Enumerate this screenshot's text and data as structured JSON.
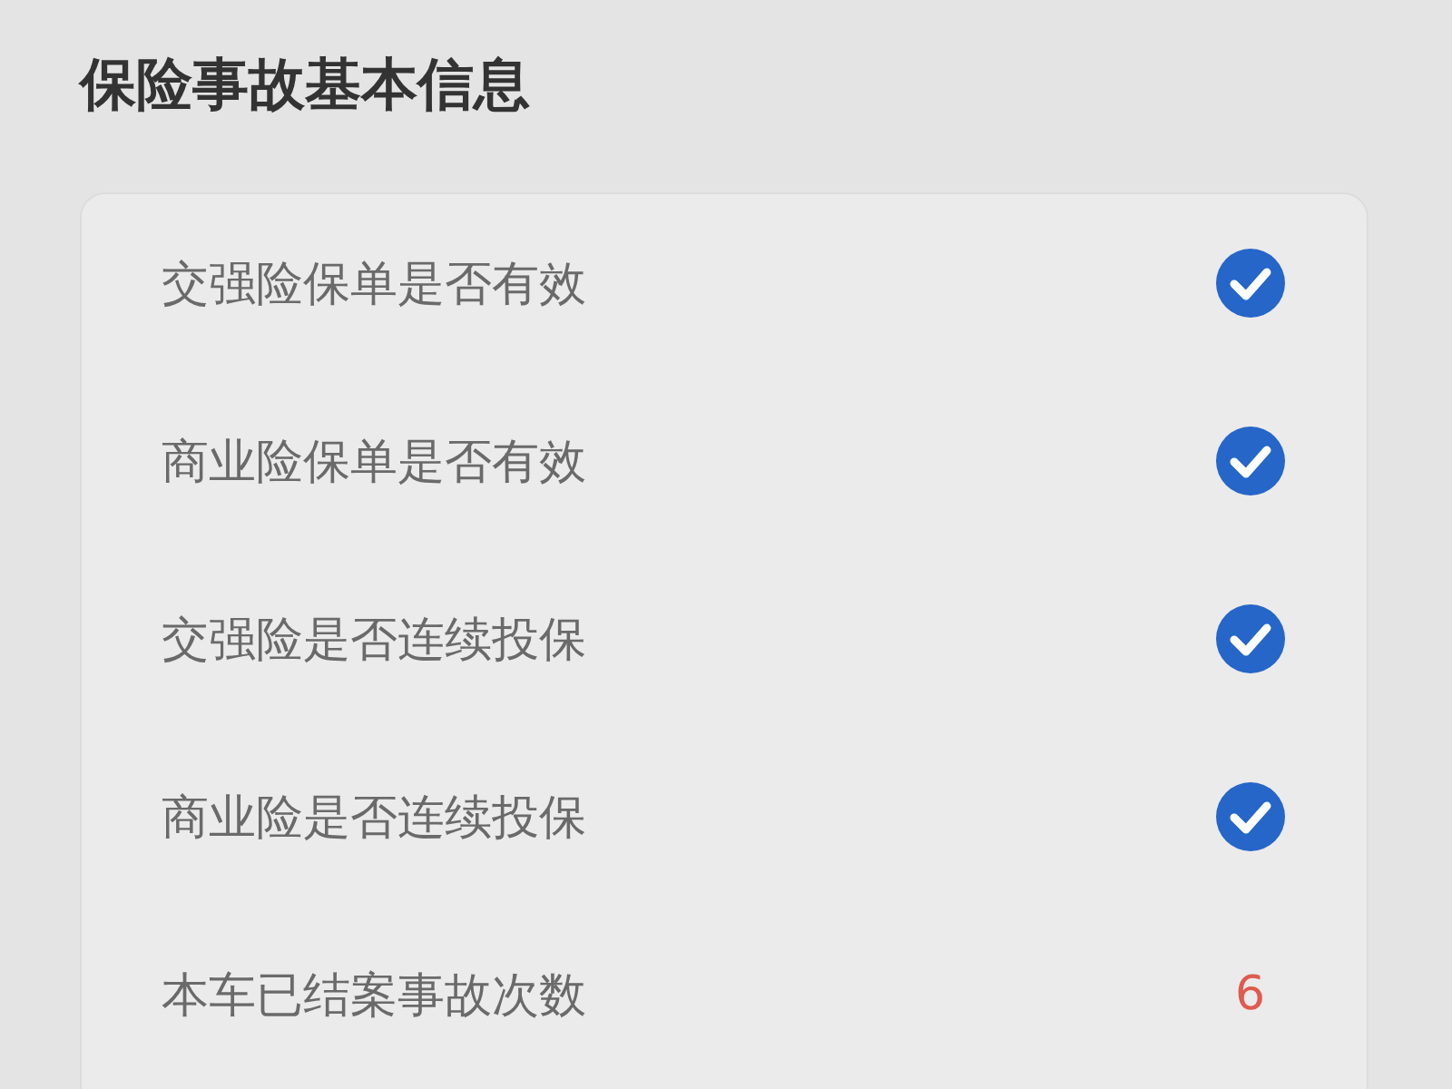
{
  "section_title": "保险事故基本信息",
  "rows": [
    {
      "kind": "check",
      "label": "交强险保单是否有效",
      "checked": true
    },
    {
      "kind": "check",
      "label": "商业险保单是否有效",
      "checked": true
    },
    {
      "kind": "check",
      "label": "交强险是否连续投保",
      "checked": true
    },
    {
      "kind": "check",
      "label": "商业险是否连续投保",
      "checked": true
    },
    {
      "kind": "value",
      "label": "本车已结案事故次数",
      "value": "6"
    }
  ]
}
